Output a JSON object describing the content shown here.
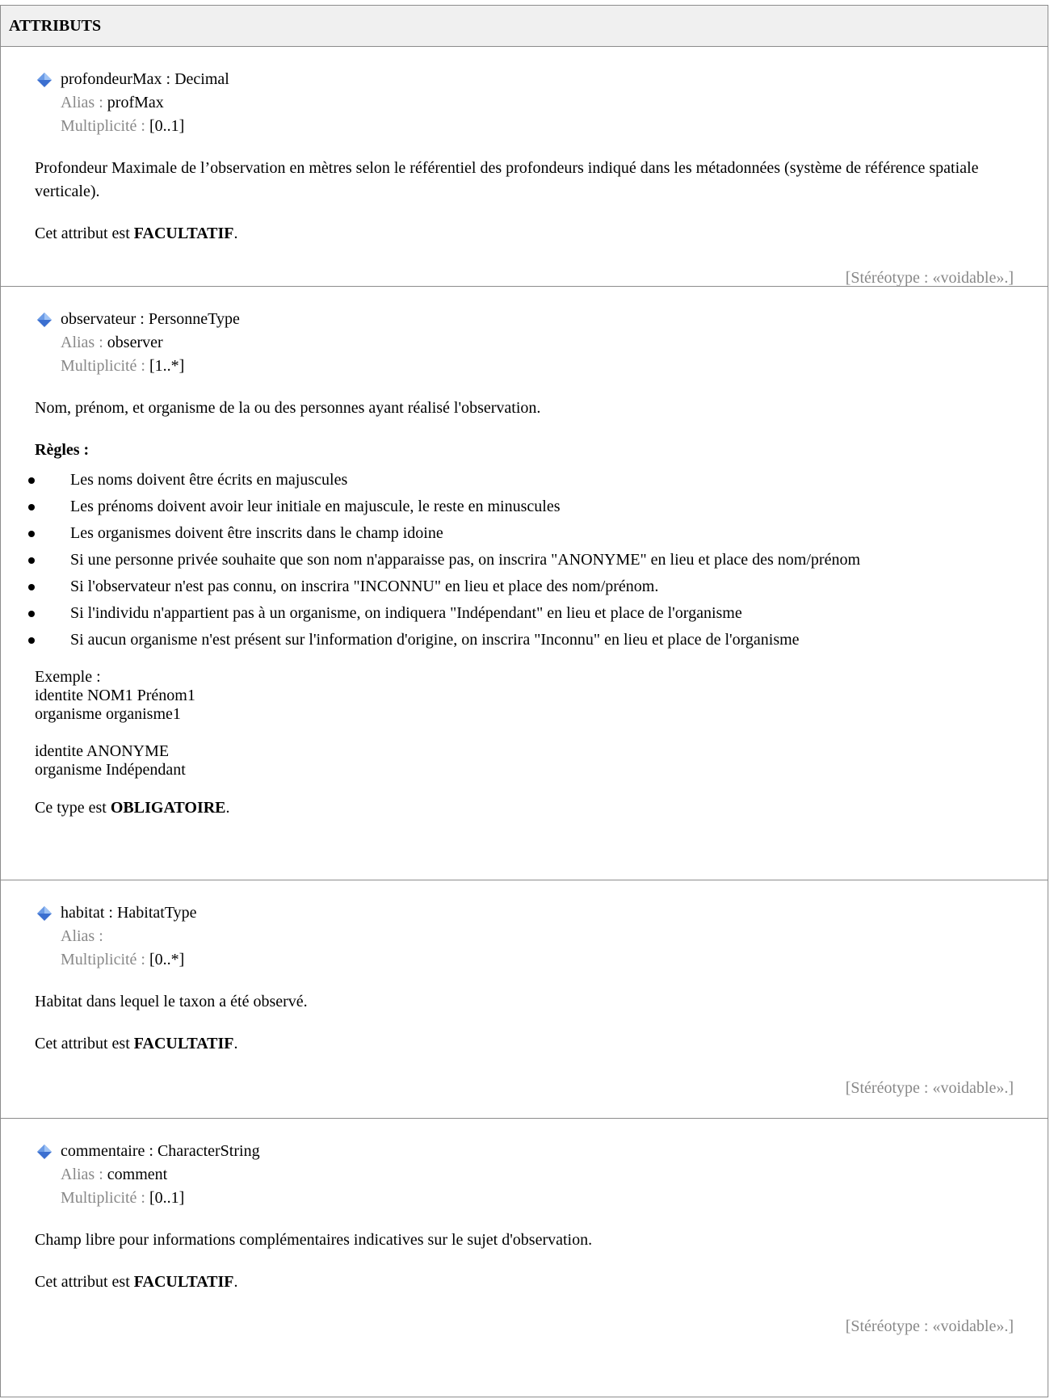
{
  "header": {
    "title": "ATTRIBUTS"
  },
  "labels": {
    "alias": "Alias :",
    "multiplicity": "Multiplicité :"
  },
  "attributes": [
    {
      "signature": "profondeurMax : Decimal",
      "alias": "profMax",
      "multiplicity": "[0..1]",
      "description": "Profondeur Maximale de l’observation en mètres selon le référentiel des profondeurs indiqué dans les métadonnées (système de référence spatiale verticale).",
      "requirement_prefix": "Cet attribut est ",
      "requirement": "FACULTATIF",
      "stereotype": "[Stéréotype : «voidable».]"
    },
    {
      "signature": "observateur : PersonneType",
      "alias": "observer",
      "multiplicity": "[1..*]",
      "description": "Nom, prénom, et organisme de la ou des personnes ayant réalisé l'observation.",
      "rules_title": "Règles :",
      "rules": [
        "Les noms doivent être écrits en majuscules",
        "Les prénoms doivent avoir leur initiale en majuscule, le reste en minuscules",
        "Les organismes doivent être inscrits dans le champ idoine",
        "Si une personne privée souhaite que son nom n'apparaisse pas, on inscrira \"ANONYME\" en lieu et place des nom/prénom",
        "Si l'observateur n'est pas connu, on inscrira \"INCONNU\" en lieu et place des nom/prénom.",
        "Si l'individu n'appartient pas à un organisme, on indiquera \"Indépendant\" en lieu et place de l'organisme",
        "Si aucun organisme n'est présent sur l'information d'origine, on inscrira \"Inconnu\" en lieu et place de l'organisme"
      ],
      "example": {
        "title": "Exemple :",
        "line1": "identite NOM1 Prénom1",
        "line2": "organisme organisme1",
        "line3": "identite ANONYME",
        "line4": "organisme Indépendant"
      },
      "requirement_prefix": "Ce type est ",
      "requirement": "OBLIGATOIRE"
    },
    {
      "signature": "habitat : HabitatType",
      "alias": "",
      "multiplicity": "[0..*]",
      "description": "Habitat dans lequel le taxon a été observé.",
      "requirement_prefix": "Cet attribut est ",
      "requirement": "FACULTATIF",
      "stereotype": "[Stéréotype : «voidable».]"
    },
    {
      "signature": "commentaire : CharacterString",
      "alias": "comment",
      "multiplicity": "[0..1]",
      "description": "Champ libre pour informations complémentaires indicatives sur le sujet d'observation.",
      "requirement_prefix": "Cet attribut est ",
      "requirement": "FACULTATIF",
      "stereotype": "[Stéréotype : «voidable».]"
    }
  ],
  "colors": {
    "border": "#8c8c8c",
    "header_bg": "#f0f0f0",
    "muted": "#888888",
    "icon": "#4a7fd4"
  },
  "icon_name": "attribute-diamond-icon"
}
